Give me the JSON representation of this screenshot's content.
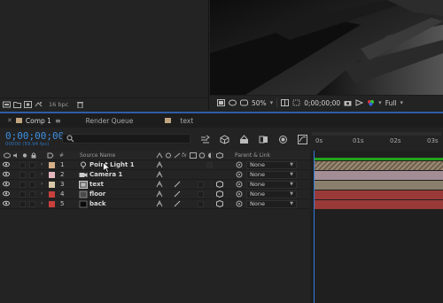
{
  "project_panel": {
    "bit_depth": "16 bpc"
  },
  "viewer": {
    "zoom": "50%",
    "timecode": "0;00;00;00",
    "resolution": "Full"
  },
  "tabs": [
    {
      "label": "Comp 1",
      "active": true
    },
    {
      "label": "Render Queue",
      "active": false
    },
    {
      "label": "text",
      "active": false
    }
  ],
  "timeline": {
    "timecode": "0;00;00;00",
    "fps": "00000 (59.94 fps)",
    "search_placeholder": ""
  },
  "ruler": {
    "labels": [
      "0s",
      "01s",
      "02s",
      "03s"
    ]
  },
  "columns": {
    "number": "#",
    "source_name": "Source Name",
    "parent_link": "Parent & Link"
  },
  "layers": [
    {
      "number": "1",
      "name": "Point Light 1",
      "type": "light",
      "label_color": "#d6b08a",
      "parent": "None",
      "bar_color": "#8c7c68",
      "bar_pattern": true
    },
    {
      "number": "2",
      "name": "Camera 1",
      "type": "camera",
      "label_color": "#e3b6c0",
      "parent": "None",
      "bar_color": "#a48e95",
      "bar_pattern": false
    },
    {
      "number": "3",
      "name": "text",
      "type": "precomp",
      "label_color": "#d8c8a8",
      "parent": "None",
      "bar_color": "#8a7f6c",
      "bar_pattern": false
    },
    {
      "number": "4",
      "name": "floor",
      "type": "solid",
      "label_color": "#c9403d",
      "parent": "None",
      "bar_color": "#9a3a38",
      "bar_pattern": false
    },
    {
      "number": "5",
      "name": "back",
      "type": "solid",
      "label_color": "#c9403d",
      "parent": "None",
      "bar_color": "#9a3a38",
      "bar_pattern": false
    }
  ],
  "colors": {
    "accent": "#2f7de0",
    "work_area": "#23a31c",
    "timecode": "#3d8fe0"
  }
}
